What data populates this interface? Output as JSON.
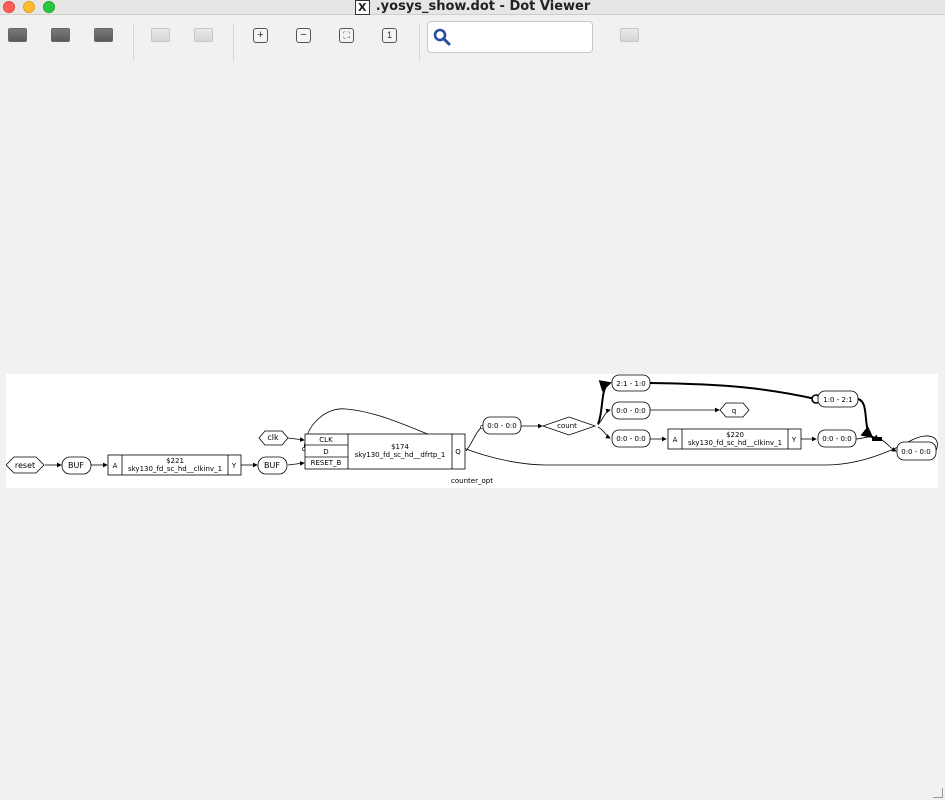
{
  "window": {
    "title": ".yosys_show.dot - Dot Viewer",
    "app_icon": "x11-icon"
  },
  "toolbar": {
    "buttons": [
      {
        "name": "open-button",
        "icon": "document-icon",
        "enabled": true
      },
      {
        "name": "reload-button",
        "icon": "document-icon",
        "enabled": true
      },
      {
        "name": "print-button",
        "icon": "document-icon",
        "enabled": true
      },
      {
        "name": "back-button",
        "icon": "document-icon",
        "enabled": false
      },
      {
        "name": "forward-button",
        "icon": "document-icon",
        "enabled": false
      },
      {
        "name": "zoom-in-button",
        "icon": "plus-icon",
        "enabled": true
      },
      {
        "name": "zoom-out-button",
        "icon": "minus-icon",
        "enabled": true
      },
      {
        "name": "zoom-fit-button",
        "icon": "fit-icon",
        "enabled": true
      },
      {
        "name": "zoom-100-button",
        "icon": "one-icon",
        "enabled": true
      },
      {
        "name": "find-next-button",
        "icon": "document-icon",
        "enabled": false
      }
    ],
    "search": {
      "value": "",
      "placeholder": "",
      "icon": "magnifier-icon"
    }
  },
  "graph": {
    "caption": "counter_opt",
    "nodes": {
      "reset": "reset",
      "buf1": "BUF",
      "cell221_id": "$221",
      "cell221_type": "sky130_fd_sc_hd__clkinv_1",
      "cell221_in": "A",
      "cell221_out": "Y",
      "buf2": "BUF",
      "clk": "clk",
      "cell174_clk": "CLK",
      "cell174_d": "D",
      "cell174_reset": "RESET_B",
      "cell174_id": "$174",
      "cell174_type": "sky130_fd_sc_hd__dfrtp_1",
      "cell174_q": "Q",
      "slice_q": "0:0 - 0:0",
      "count": "count",
      "slice_2_1": "2:1 - 1:0",
      "slice_q_out": "0:0 - 0:0",
      "q": "q",
      "slice_inv_in": "0:0 - 0:0",
      "cell220_in": "A",
      "cell220_id": "$220",
      "cell220_type": "sky130_fd_sc_hd__clkinv_1",
      "cell220_out": "Y",
      "slice_inv_out": "0:0 - 0:0",
      "slice_1_2": "1:0 - 2:1",
      "slice_feedback": "0:0 - 0:0"
    }
  }
}
